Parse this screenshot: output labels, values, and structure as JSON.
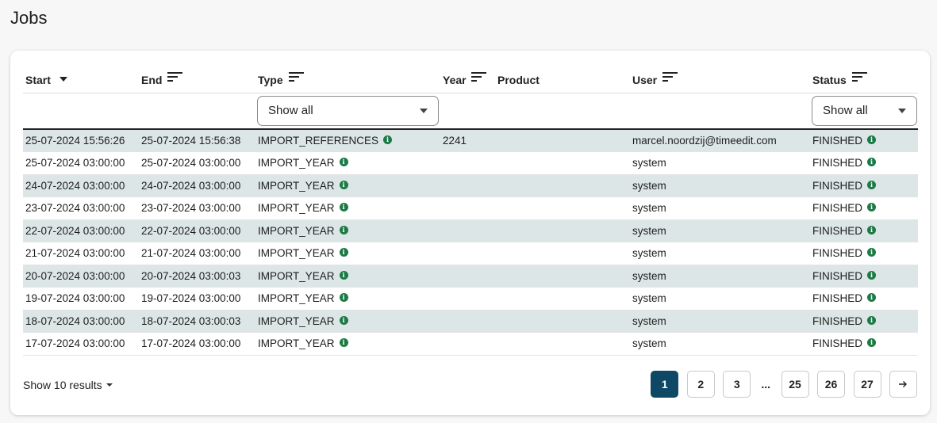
{
  "page": {
    "title": "Jobs"
  },
  "table": {
    "columns": [
      {
        "key": "start",
        "label": "Start"
      },
      {
        "key": "end",
        "label": "End"
      },
      {
        "key": "type",
        "label": "Type"
      },
      {
        "key": "year",
        "label": "Year"
      },
      {
        "key": "product",
        "label": "Product"
      },
      {
        "key": "user",
        "label": "User"
      },
      {
        "key": "status",
        "label": "Status"
      }
    ],
    "filters": {
      "type": {
        "selected": "Show all"
      },
      "status": {
        "selected": "Show all"
      }
    },
    "rows": [
      {
        "start": "25-07-2024 15:56:26",
        "end": "25-07-2024 15:56:38",
        "type": "IMPORT_REFERENCES",
        "year": "2241",
        "product": "",
        "user": "marcel.noordzij@timeedit.com",
        "status": "FINISHED"
      },
      {
        "start": "25-07-2024 03:00:00",
        "end": "25-07-2024 03:00:00",
        "type": "IMPORT_YEAR",
        "year": "",
        "product": "",
        "user": "system",
        "status": "FINISHED"
      },
      {
        "start": "24-07-2024 03:00:00",
        "end": "24-07-2024 03:00:00",
        "type": "IMPORT_YEAR",
        "year": "",
        "product": "",
        "user": "system",
        "status": "FINISHED"
      },
      {
        "start": "23-07-2024 03:00:00",
        "end": "23-07-2024 03:00:00",
        "type": "IMPORT_YEAR",
        "year": "",
        "product": "",
        "user": "system",
        "status": "FINISHED"
      },
      {
        "start": "22-07-2024 03:00:00",
        "end": "22-07-2024 03:00:00",
        "type": "IMPORT_YEAR",
        "year": "",
        "product": "",
        "user": "system",
        "status": "FINISHED"
      },
      {
        "start": "21-07-2024 03:00:00",
        "end": "21-07-2024 03:00:00",
        "type": "IMPORT_YEAR",
        "year": "",
        "product": "",
        "user": "system",
        "status": "FINISHED"
      },
      {
        "start": "20-07-2024 03:00:00",
        "end": "20-07-2024 03:00:03",
        "type": "IMPORT_YEAR",
        "year": "",
        "product": "",
        "user": "system",
        "status": "FINISHED"
      },
      {
        "start": "19-07-2024 03:00:00",
        "end": "19-07-2024 03:00:00",
        "type": "IMPORT_YEAR",
        "year": "",
        "product": "",
        "user": "system",
        "status": "FINISHED"
      },
      {
        "start": "18-07-2024 03:00:00",
        "end": "18-07-2024 03:00:03",
        "type": "IMPORT_YEAR",
        "year": "",
        "product": "",
        "user": "system",
        "status": "FINISHED"
      },
      {
        "start": "17-07-2024 03:00:00",
        "end": "17-07-2024 03:00:00",
        "type": "IMPORT_YEAR",
        "year": "",
        "product": "",
        "user": "system",
        "status": "FINISHED"
      }
    ]
  },
  "footer": {
    "results_label": "Show 10 results",
    "pages": [
      "1",
      "2",
      "3",
      "...",
      "25",
      "26",
      "27"
    ],
    "current_page": "1",
    "next_icon": "arrow-right-icon"
  },
  "colors": {
    "accent": "#0e4865",
    "info_icon": "#1b7a45",
    "row_stripe": "#dde6e6"
  }
}
